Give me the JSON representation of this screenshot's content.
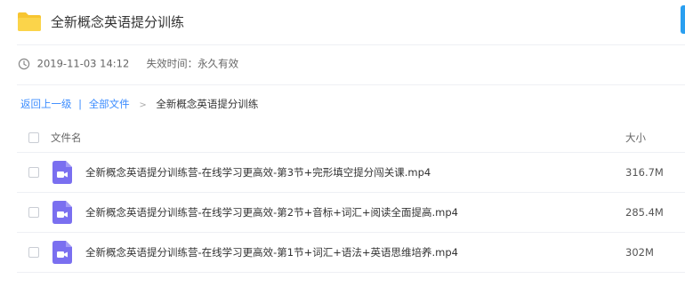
{
  "share": {
    "title": "全新概念英语提分训练",
    "date": "2019-11-03 14:12",
    "expiry": "失效时间：永久有效"
  },
  "breadcrumb": {
    "back": "返回上一级",
    "separator": "|",
    "all_files": "全部文件",
    "arrow": ">",
    "current": "全新概念英语提分训练"
  },
  "table": {
    "headers": {
      "name": "文件名",
      "size": "大小"
    },
    "rows": [
      {
        "name": "全新概念英语提分训练营-在线学习更高效-第3节+完形填空提分闯关课.mp4",
        "size": "316.7M"
      },
      {
        "name": "全新概念英语提分训练营-在线学习更高效-第2节+音标+词汇+阅读全面提高.mp4",
        "size": "285.4M"
      },
      {
        "name": "全新概念英语提分训练营-在线学习更高效-第1节+词汇+语法+英语思维培养.mp4",
        "size": "302M"
      }
    ]
  },
  "icons": {
    "folder": "folder-icon",
    "clock": "clock-icon",
    "video": "video-file-icon"
  },
  "colors": {
    "folder": "#f7c531",
    "link": "#3b8cff",
    "video_icon": "#7a6ff0",
    "accent": "#2a9ff0"
  }
}
